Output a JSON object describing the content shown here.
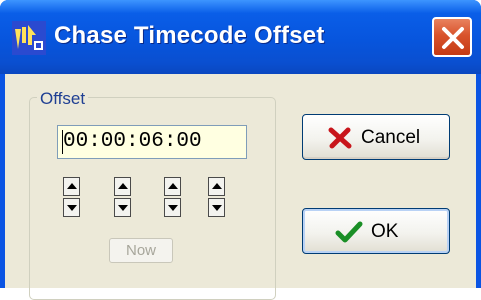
{
  "window": {
    "title": "Chase Timecode Offset",
    "app_icon": "app-icon",
    "close_icon": "close-icon"
  },
  "group": {
    "label": "Offset",
    "timecode_value": "00:00:06:00",
    "spinners": [
      {
        "up_icon": "arrow-up-icon",
        "down_icon": "arrow-down-icon"
      },
      {
        "up_icon": "arrow-up-icon",
        "down_icon": "arrow-down-icon"
      },
      {
        "up_icon": "arrow-up-icon",
        "down_icon": "arrow-down-icon"
      },
      {
        "up_icon": "arrow-up-icon",
        "down_icon": "arrow-down-icon"
      }
    ],
    "now_label": "Now"
  },
  "buttons": {
    "cancel_label": "Cancel",
    "cancel_icon": "x-icon",
    "ok_label": "OK",
    "ok_icon": "checkmark-icon"
  }
}
